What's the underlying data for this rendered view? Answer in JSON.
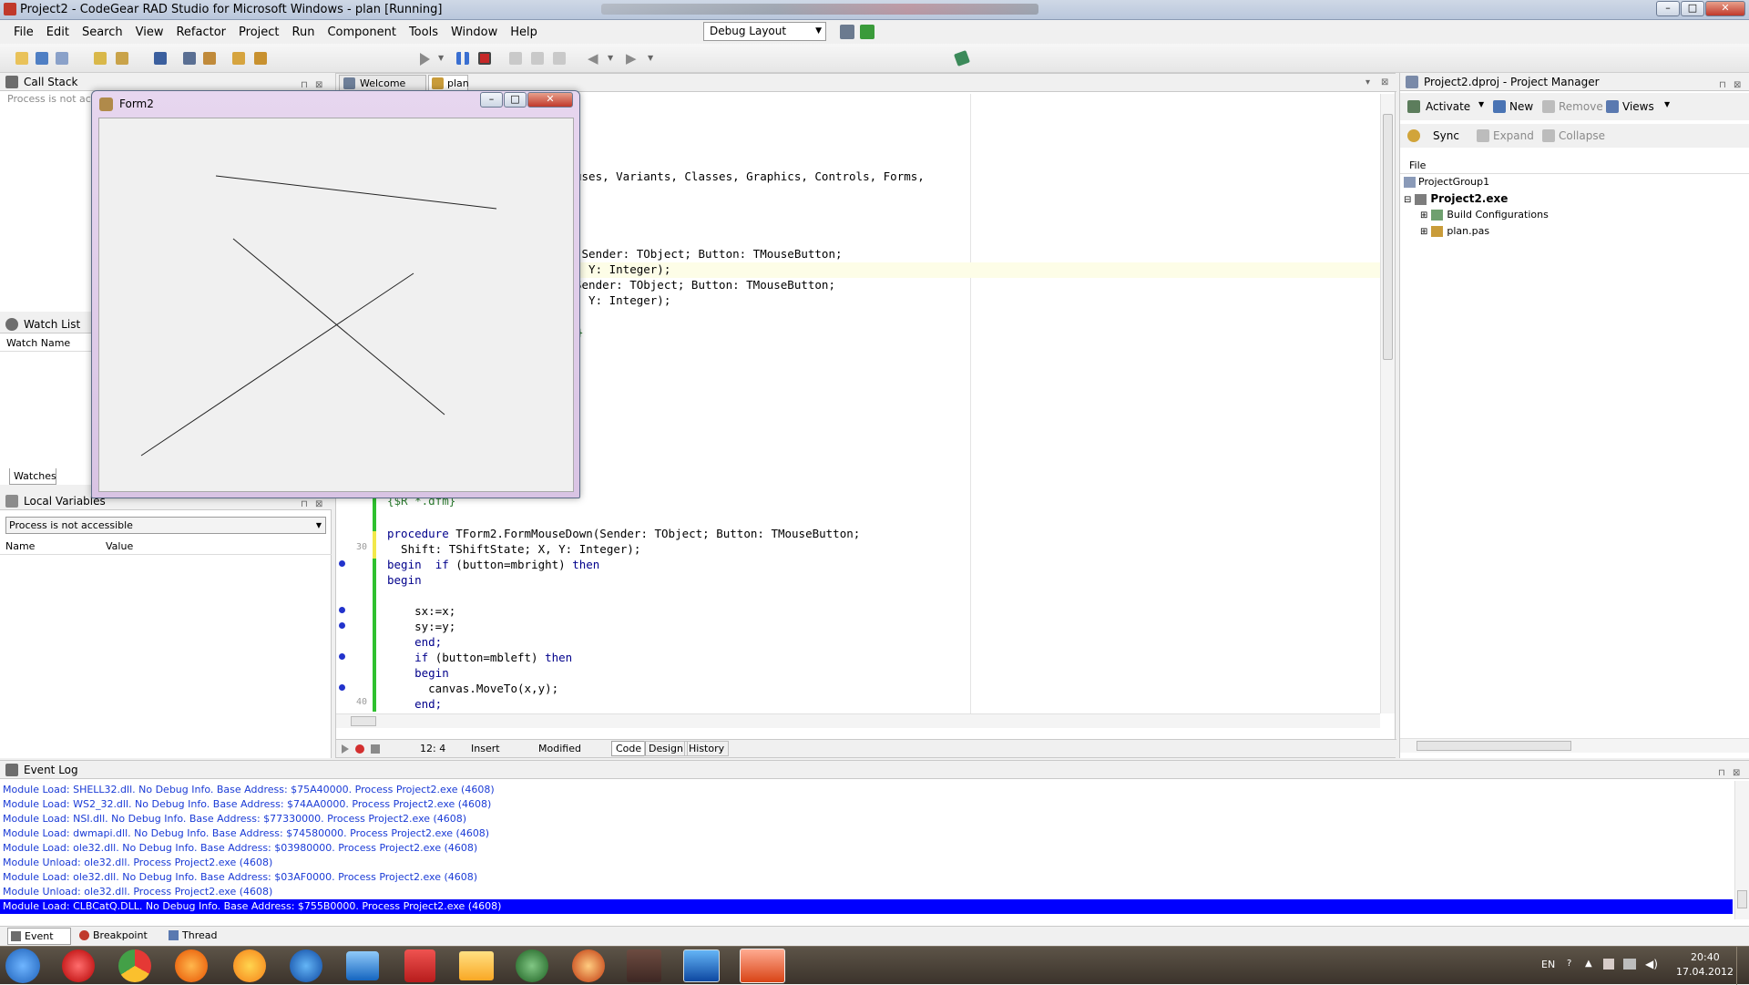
{
  "window": {
    "title": "Project2 - CodeGear RAD Studio for Microsoft Windows - plan [Running]",
    "min": "–",
    "max": "□",
    "close": "✕"
  },
  "menu": [
    "File",
    "Edit",
    "Search",
    "View",
    "Refactor",
    "Project",
    "Run",
    "Component",
    "Tools",
    "Window",
    "Help"
  ],
  "layout_select": {
    "value": "Debug Layout"
  },
  "call_stack": {
    "title": "Call Stack",
    "status": "Process is not accessible"
  },
  "watch_list": {
    "title": "Watch List",
    "column": "Watch Name",
    "tab": "Watches"
  },
  "local_vars": {
    "title": "Local Variables",
    "select": "Process is not accessible",
    "col_name": "Name",
    "col_value": "Value"
  },
  "editor": {
    "tabs": [
      "Welcome Page",
      "plan"
    ],
    "line_numbers": {
      "l30": "30",
      "l40": "40"
    },
    "status": {
      "pos": "12: 4",
      "mode": "Insert",
      "state": "Modified"
    },
    "bottom_tabs": [
      "Code",
      "Design",
      "History"
    ],
    "frag": {
      "f1": "uses, Variants, Classes, Graphics, Controls, Forms,",
      "f2": "(Sender: TObject; Button: TMouseButton;",
      "f3": ", Y: Integer);",
      "f4": "Sender: TObject; Button: TMouseButton;",
      "f5": ", Y: Integer);",
      "f6": "}"
    },
    "code": {
      "c0": "{$R *.dfm}",
      "c1_kw": "procedure",
      "c1": " TForm2.FormMouseDown(Sender: TObject; Button: TMouseButton;",
      "c2": "  Shift: TShiftState; X, Y: Integer);",
      "c3_kw": "begin",
      "c3_a": "  ",
      "c3_kw2": "if",
      "c3_b": " (button=mbright) ",
      "c3_kw3": "then",
      "c4_kw": "begin",
      "c5": "    sx:=x;",
      "c6": "    sy:=y;",
      "c7_kw": "    end;",
      "c8_a": "    ",
      "c8_kw": "if",
      "c8_b": " (button=mbleft) ",
      "c8_kw2": "then",
      "c9_kw": "    begin",
      "c10": "      canvas.MoveTo(x,y);",
      "c11_kw": "    end;"
    }
  },
  "form2": {
    "title": "Form2"
  },
  "project_manager": {
    "title": "Project2.dproj - Project Manager",
    "buttons": {
      "activate": "Activate",
      "new": "New",
      "remove": "Remove",
      "views": "Views",
      "sync": "Sync",
      "expand": "Expand",
      "collapse": "Collapse"
    },
    "column": "File",
    "tree": {
      "group": "ProjectGroup1",
      "project": "Project2.exe",
      "build": "Build Configurations",
      "unit": "plan.pas"
    }
  },
  "event_log": {
    "title": "Event Log",
    "lines": [
      "Module Load: SHELL32.dll. No Debug Info. Base Address: $75A40000. Process Project2.exe (4608)",
      "Module Load: WS2_32.dll. No Debug Info. Base Address: $74AA0000. Process Project2.exe (4608)",
      "Module Load: NSI.dll. No Debug Info. Base Address: $77330000. Process Project2.exe (4608)",
      "Module Load: dwmapi.dll. No Debug Info. Base Address: $74580000. Process Project2.exe (4608)",
      "Module Load: ole32.dll. No Debug Info. Base Address: $03980000. Process Project2.exe (4608)",
      "Module Unload: ole32.dll. Process Project2.exe (4608)",
      "Module Load: ole32.dll. No Debug Info. Base Address: $03AF0000. Process Project2.exe (4608)",
      "Module Unload: ole32.dll. Process Project2.exe (4608)",
      "Module Load: CLBCatQ.DLL. No Debug Info. Base Address: $755B0000. Process Project2.exe (4608)"
    ],
    "tabs": [
      "Event Log",
      "Breakpoint List",
      "Thread Status"
    ]
  },
  "taskbar": {
    "lang": "EN",
    "time": "20:40",
    "date": "17.04.2012"
  }
}
